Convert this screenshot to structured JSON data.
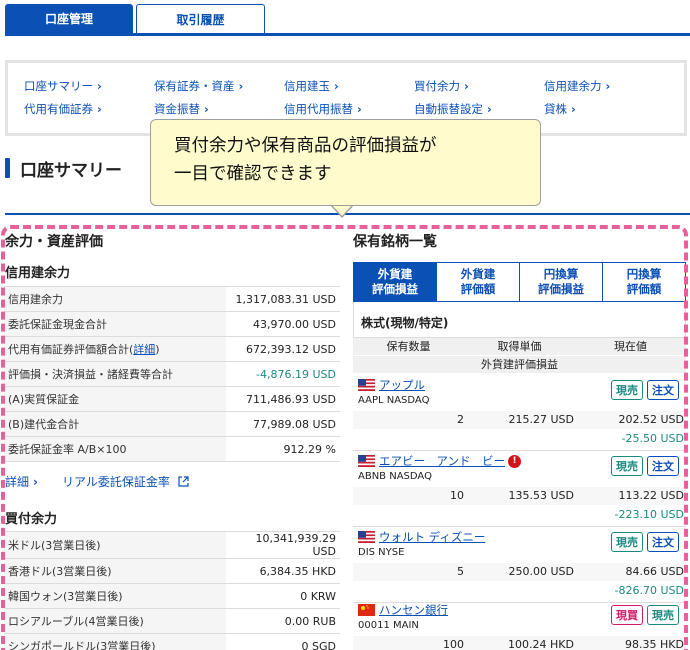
{
  "tabs": {
    "account": "口座管理",
    "history": "取引履歴"
  },
  "links": [
    "口座サマリー",
    "保有証券・資産",
    "信用建玉",
    "買付余力",
    "信用建余力",
    "代用有価証券",
    "資金振替",
    "信用代用振替",
    "自動振替設定",
    "貸株"
  ],
  "summary_title": "口座サマリー",
  "callout": {
    "line1": "買付余力や保有商品の評価損益が",
    "line2": "一目で確認できます"
  },
  "left": {
    "heading": "余力・資産評価",
    "credit": {
      "title": "信用建余力",
      "rows": [
        {
          "label": "信用建余力",
          "value": "1,317,083.31 USD"
        },
        {
          "label": "委託保証金現金合計",
          "value": "43,970.00 USD"
        },
        {
          "label": "代用有価証券評価額合計(",
          "link": "詳細",
          "tail": ")",
          "value": "672,393.12 USD"
        },
        {
          "label": "評価損・決済損益・諸経費等合計",
          "value": "-4,876.19 USD"
        },
        {
          "label": "(A)実質保証金",
          "value": "711,486.93 USD"
        },
        {
          "label": "(B)建代金合計",
          "value": "77,989.08 USD"
        },
        {
          "label": "委託保証金率 A/B×100",
          "value": "912.29 %"
        }
      ],
      "detail_link": "詳細",
      "realtime_link": "リアル委託保証金率"
    },
    "buying": {
      "title": "買付余力",
      "rows": [
        {
          "label": "米ドル(3営業日後)",
          "value": "10,341,939.29 USD"
        },
        {
          "label": "香港ドル(3営業日後)",
          "value": "6,384.35 HKD"
        },
        {
          "label": "韓国ウォン(3営業日後)",
          "value": "0 KRW"
        },
        {
          "label": "ロシアルーブル(4営業日後)",
          "value": "0.00 RUB"
        },
        {
          "label": "シンガポールドル(3営業日後)",
          "value": "0 SGD"
        }
      ]
    }
  },
  "right": {
    "heading": "保有銘柄一覧",
    "tabs": [
      {
        "l1": "外貨建",
        "l2": "評価損益"
      },
      {
        "l1": "外貨建",
        "l2": "評価額"
      },
      {
        "l1": "円換算",
        "l2": "評価損益"
      },
      {
        "l1": "円換算",
        "l2": "評価額"
      }
    ],
    "stock_heading": "株式(現物/特定)",
    "col_qty": "保有数量",
    "col_cost": "取得単価",
    "col_price": "現在値",
    "col_pl": "外貨建評価損益",
    "stocks": [
      {
        "name": "アップル",
        "code": "AAPL NASDAQ",
        "qty": "2",
        "cost": "215.27 USD",
        "price": "202.52 USD",
        "pl": "-25.50 USD",
        "btn1": "現売",
        "btn2": "注文"
      },
      {
        "name": "エアビー　アンド　ビー",
        "code": "ABNB NASDAQ",
        "qty": "10",
        "cost": "135.53 USD",
        "price": "113.22 USD",
        "pl": "-223.10 USD",
        "btn1": "現売",
        "btn2": "注文"
      },
      {
        "name": "ウォルト ディズニー",
        "code": "DIS NYSE",
        "qty": "5",
        "cost": "250.00 USD",
        "price": "84.66 USD",
        "pl": "-826.70 USD",
        "btn1": "現売",
        "btn2": "注文"
      },
      {
        "name": "ハンセン銀行",
        "code": "00011 MAIN",
        "qty": "100",
        "cost": "100.24 HKD",
        "price": "98.35 HKD",
        "pl": "",
        "btn1": "現買",
        "btn2": "現売"
      }
    ],
    "info_icon": "!"
  },
  "colors": {
    "accent": "#0b50b4",
    "negative": "#1a8a80",
    "callout_bg": "#fffbcc",
    "frame": "#e8609b"
  }
}
